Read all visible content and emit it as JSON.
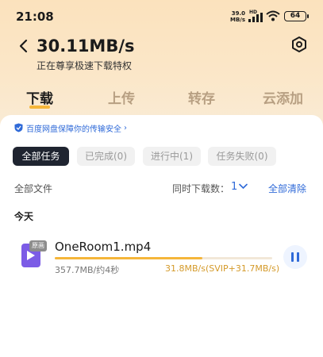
{
  "status_bar": {
    "time": "21:08",
    "net_speed_value": "39.0",
    "net_speed_unit": "MB/s",
    "network_label": "HD",
    "battery": "64"
  },
  "header": {
    "title": "30.11MB/s",
    "subtitle": "正在尊享极速下载特权"
  },
  "tabs": [
    {
      "label": "下载",
      "active": true
    },
    {
      "label": "上传",
      "active": false
    },
    {
      "label": "转存",
      "active": false
    },
    {
      "label": "云添加",
      "active": false
    }
  ],
  "security_notice": "百度网盘保障你的传输安全",
  "filters": [
    {
      "label": "全部任务",
      "active": true
    },
    {
      "label": "已完成(0)",
      "active": false
    },
    {
      "label": "进行中(1)",
      "active": false
    },
    {
      "label": "任务失败(0)",
      "active": false
    }
  ],
  "list_header": {
    "all_files": "全部文件",
    "concurrent_label": "同时下载数：",
    "concurrent_value": "1",
    "clear_all": "全部清除"
  },
  "section": "今天",
  "downloads": [
    {
      "name": "OneRoom1.mp4",
      "badge": "原画",
      "size_info": "357.7MB/约4秒",
      "speed": "31.8MB/s(SVIP+31.7MB/s)",
      "progress": 0.68
    }
  ],
  "colors": {
    "accent": "#f5b63a",
    "link": "#2f6ad8",
    "file_icon": "#7c5ce6"
  }
}
